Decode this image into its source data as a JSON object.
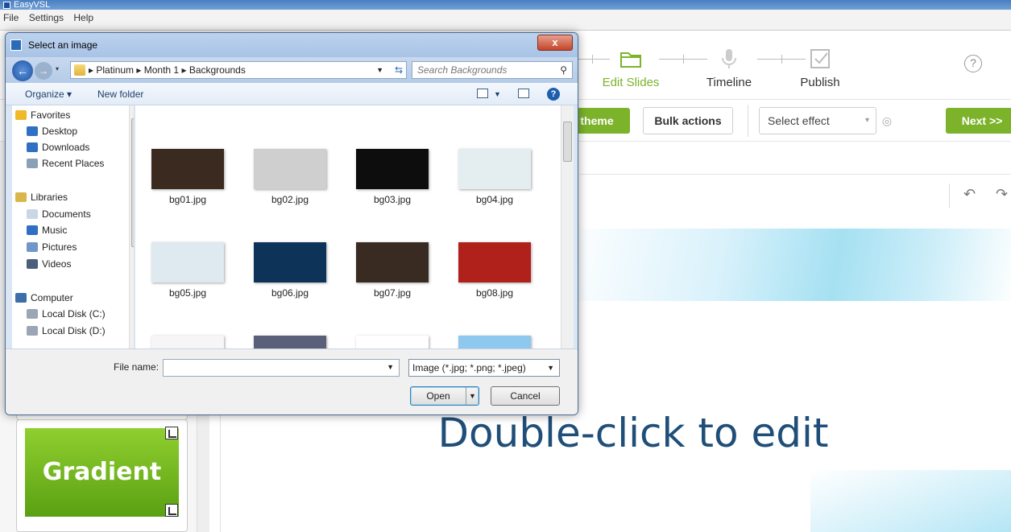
{
  "app": {
    "title": "EasyVSL",
    "menu": [
      "File",
      "Settings",
      "Help"
    ]
  },
  "steps": [
    {
      "label": "Edit Slides",
      "icon": "folder-icon",
      "active": true
    },
    {
      "label": "Timeline",
      "icon": "microphone-icon",
      "active": false
    },
    {
      "label": "Publish",
      "icon": "checkbox-icon",
      "active": false
    }
  ],
  "toolbar": {
    "theme_label": "theme",
    "bulk_label": "Bulk actions",
    "effect_placeholder": "Select effect",
    "next_label": "Next >>",
    "help_glyph": "?"
  },
  "left_panel": {
    "tile_label": "Gradient"
  },
  "slide": {
    "text": "Double-click to edit"
  },
  "dialog": {
    "title": "Select an image",
    "close_glyph": "x",
    "breadcrumb": [
      "Platinum",
      "Month 1",
      "Backgrounds"
    ],
    "search_placeholder": "Search Backgrounds",
    "organize_label": "Organize ▾",
    "new_folder_label": "New folder",
    "nav": [
      {
        "label": "Favorites",
        "icon": "star-icon",
        "header": true
      },
      {
        "label": "Desktop",
        "icon": "desktop-icon",
        "header": false
      },
      {
        "label": "Downloads",
        "icon": "downloads-icon",
        "header": false
      },
      {
        "label": "Recent Places",
        "icon": "recent-places-icon",
        "header": false
      },
      {
        "label": "Libraries",
        "icon": "libraries-icon",
        "header": true
      },
      {
        "label": "Documents",
        "icon": "documents-icon",
        "header": false
      },
      {
        "label": "Music",
        "icon": "music-icon",
        "header": false
      },
      {
        "label": "Pictures",
        "icon": "pictures-icon",
        "header": false
      },
      {
        "label": "Videos",
        "icon": "videos-icon",
        "header": false
      },
      {
        "label": "Computer",
        "icon": "computer-icon",
        "header": true
      },
      {
        "label": "Local Disk (C:)",
        "icon": "disk-icon",
        "header": false
      },
      {
        "label": "Local Disk (D:)",
        "icon": "disk-icon",
        "header": false
      }
    ],
    "files": [
      {
        "name": "bg01.jpg",
        "color": "#3b2a1f"
      },
      {
        "name": "bg02.jpg",
        "color": "#cfcfcf"
      },
      {
        "name": "bg03.jpg",
        "color": "#0d0d0d"
      },
      {
        "name": "bg04.jpg",
        "color": "#e4edf0"
      },
      {
        "name": "bg05.jpg",
        "color": "#dfe9f0"
      },
      {
        "name": "bg06.jpg",
        "color": "#0e3358"
      },
      {
        "name": "bg07.jpg",
        "color": "#3a2b22"
      },
      {
        "name": "bg08.jpg",
        "color": "#b0211c"
      },
      {
        "name": "",
        "color": "#f6f6f6"
      },
      {
        "name": "",
        "color": "#5a5f7a"
      },
      {
        "name": "",
        "color": "#ffffff"
      },
      {
        "name": "",
        "color": "#8ec8ee"
      }
    ],
    "file_name_label": "File name:",
    "file_name_value": "",
    "file_type": "Image (*.jpg; *.png; *.jpeg)",
    "open_label": "Open",
    "cancel_label": "Cancel"
  }
}
